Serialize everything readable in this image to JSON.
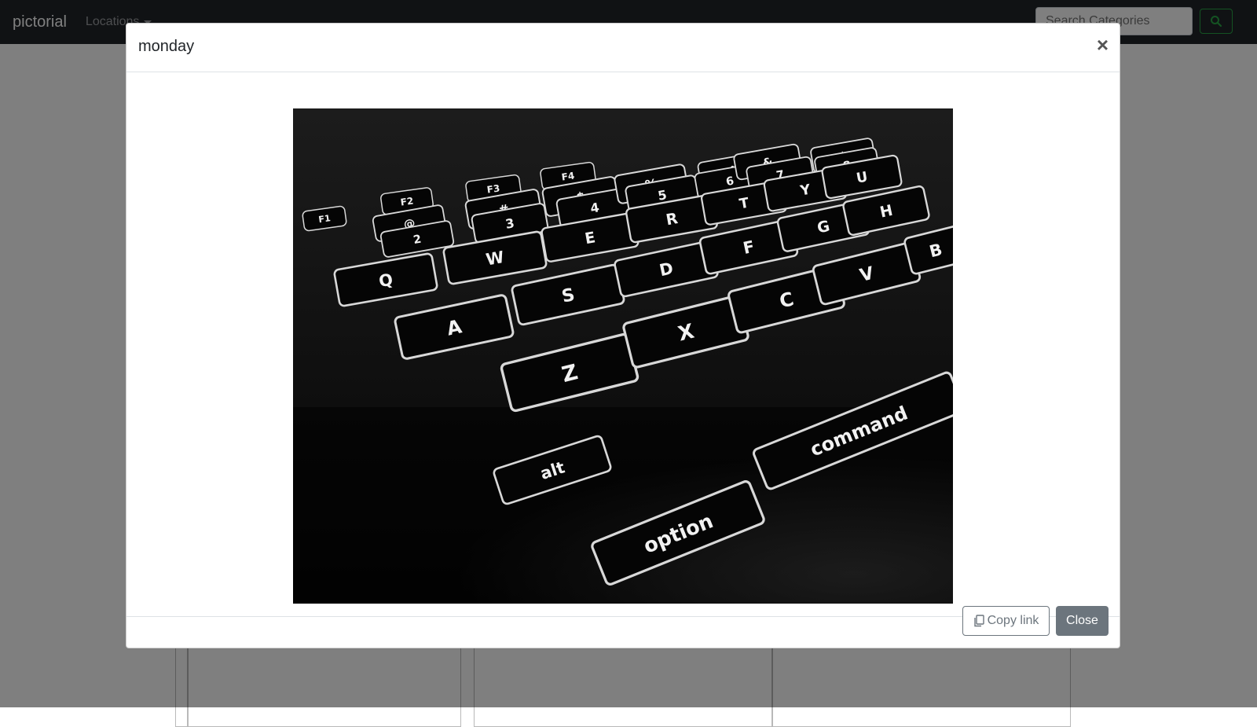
{
  "navbar": {
    "brand": "pictorial",
    "dropdown_label": "Locations",
    "search_placeholder": "Search Categories",
    "icons": {
      "search": "search-icon",
      "dropdown": "caret-down-icon"
    }
  },
  "modal": {
    "title": "monday",
    "close_symbol": "×",
    "image_alt": "Backlit laptop keyboard close-up",
    "keyboard_key_labels": [
      "F1",
      "F2",
      "F3",
      "F4",
      "@",
      "2",
      "#",
      "3",
      "$",
      "4",
      "%",
      "5",
      "^",
      "6",
      "&",
      "7",
      "*",
      "8",
      "Q",
      "W",
      "E",
      "R",
      "T",
      "Y",
      "U",
      "A",
      "S",
      "D",
      "F",
      "G",
      "H",
      "Z",
      "X",
      "C",
      "V",
      "B",
      "alt",
      "option",
      "command"
    ],
    "footer": {
      "copy_link_label": "Copy link",
      "close_label": "Close",
      "icons": {
        "copy": "copy-icon"
      }
    }
  },
  "colors": {
    "navbar": "#212529",
    "backdrop": "rgba(0,0,0,0.5)",
    "search_button_border": "#28a745",
    "secondary_button": "#6c757d"
  }
}
